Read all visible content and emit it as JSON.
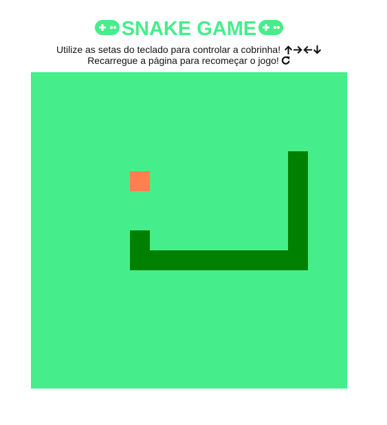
{
  "header": {
    "title": "SNAKE GAME",
    "icon": "gamepad-icon"
  },
  "instructions": {
    "line1": "Utilize as setas do teclado para controlar a cobrinha!",
    "line1_icons": [
      "arrow-up-icon",
      "arrow-right-icon",
      "arrow-left-icon",
      "arrow-down-icon"
    ],
    "line2": "Recarregue a página para recomeçar o jogo!",
    "line2_icon": "refresh-icon"
  },
  "game": {
    "grid_cols": 16,
    "grid_rows": 16,
    "food": {
      "col": 5,
      "row": 5
    },
    "snake": [
      {
        "col": 13,
        "row": 4
      },
      {
        "col": 13,
        "row": 5
      },
      {
        "col": 13,
        "row": 6
      },
      {
        "col": 13,
        "row": 7
      },
      {
        "col": 13,
        "row": 8
      },
      {
        "col": 13,
        "row": 9
      },
      {
        "col": 12,
        "row": 9
      },
      {
        "col": 11,
        "row": 9
      },
      {
        "col": 10,
        "row": 9
      },
      {
        "col": 9,
        "row": 9
      },
      {
        "col": 8,
        "row": 9
      },
      {
        "col": 7,
        "row": 9
      },
      {
        "col": 6,
        "row": 9
      },
      {
        "col": 5,
        "row": 9
      },
      {
        "col": 5,
        "row": 8
      }
    ]
  },
  "colors": {
    "title": "#45ee8a",
    "board": "#45ee8a",
    "snake": "#008000",
    "food": "#ff7f50",
    "text": "#111111"
  }
}
